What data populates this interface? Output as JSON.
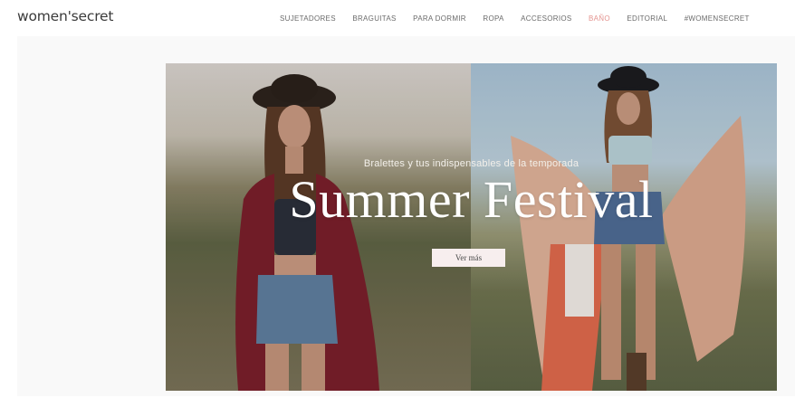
{
  "header": {
    "logo": "women'secret",
    "nav": [
      {
        "label": "SUJETADORES",
        "active": false
      },
      {
        "label": "BRAGUITAS",
        "active": false
      },
      {
        "label": "PARA DORMIR",
        "active": false
      },
      {
        "label": "ROPA",
        "active": false
      },
      {
        "label": "ACCESORIOS",
        "active": false
      },
      {
        "label": "BAÑO",
        "active": true
      },
      {
        "label": "EDITORIAL",
        "active": false
      },
      {
        "label": "#WOMENSECRET",
        "active": false
      }
    ]
  },
  "hero": {
    "subtitle": "Bralettes y tus indispensables de la temporada",
    "title": "Summer Festival",
    "cta_label": "Ver más"
  },
  "colors": {
    "accent_active": "#e4938f",
    "cta_bg": "#f7eeee"
  }
}
